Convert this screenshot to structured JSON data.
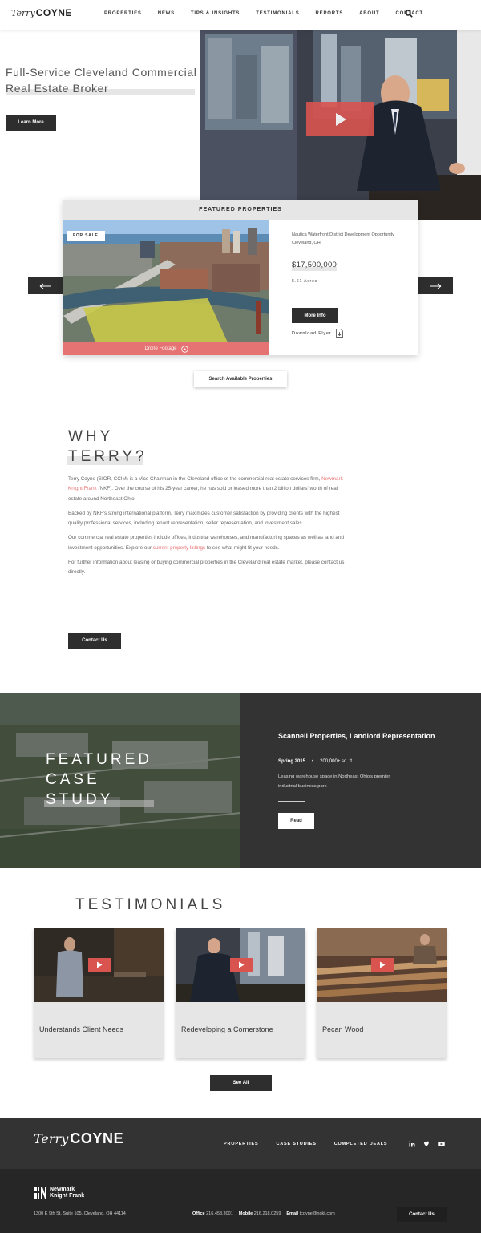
{
  "header": {
    "logo_script": "Terry",
    "logo_bold": "COYNE",
    "nav": [
      "PROPERTIES",
      "NEWS",
      "TIPS & INSIGHTS",
      "TESTIMONIALS",
      "REPORTS",
      "ABOUT",
      "CONTACT"
    ],
    "search_icon": "search-icon"
  },
  "hero": {
    "title": "Full-Service Cleveland Commercial Real Estate Broker",
    "button": "Learn More",
    "play_icon": "play-icon"
  },
  "featured": {
    "heading": "FEATURED PROPERTIES",
    "badge": "FOR SALE",
    "drone": "Drone Footage",
    "name": "Nautica Waterfront District Development Opportunity",
    "location": "Cleveland, OH",
    "price": "$17,500,000",
    "acres": "5.61 Acres",
    "more_info": "More Info",
    "download": "Download Flyer",
    "search_button": "Search Available Properties"
  },
  "why": {
    "title_line1": "WHY",
    "title_line2": "TERRY?",
    "p1_a": "Terry Coyne (SIOR, CCIM) is a Vice Chairman in the Cleveland office of the commercial real estate services firm, ",
    "p1_link": "Newmark Knight Frank",
    "p1_b": " (NKF). Over the course of his 25-year career, he has sold or leased more than 2 billion dollars' worth of real estate around Northeast Ohio.",
    "p2": "Backed by NKF's strong international platform, Terry maximizes customer satisfaction by providing clients with the highest quality professional services, including tenant representation, seller representation, and investment sales.",
    "p3_a": "Our commercial real estate properties include offices, industrial warehouses, and manufacturing spaces as well as land and investment opportunities. Explore our ",
    "p3_link": "current property listings",
    "p3_b": " to see what might fit your needs.",
    "p4": "For further information about leasing or buying commercial properties in the Cleveland real estate market, please contact us directly.",
    "button": "Contact Us"
  },
  "case_study": {
    "title_line1": "FEATURED",
    "title_line2": "CASE",
    "title_line3": "STUDY",
    "name": "Scannell Properties, Landlord Representation",
    "year": "Spring 2015",
    "sep": "•",
    "size": "200,000+ sq. ft.",
    "desc": "Leasing warehouse space in Northeast Ohio's premier industrial business park",
    "button": "Read"
  },
  "testimonials": {
    "title": "TESTIMONIALS",
    "items": [
      {
        "label": "Understands Client Needs"
      },
      {
        "label": "Redeveloping a Cornerstone"
      },
      {
        "label": "Pecan Wood"
      }
    ],
    "see_all": "See All"
  },
  "footer": {
    "logo_script": "Terry",
    "logo_bold": "COYNE",
    "nav": [
      "PROPERTIES",
      "CASE STUDIES",
      "COMPLETED DEALS"
    ],
    "social": [
      "linkedin-icon",
      "twitter-icon",
      "youtube-icon"
    ],
    "nkf_line1": "Newmark",
    "nkf_line2": "Knight Frank",
    "address": "1300 E 9th St, Suite 105, Cleveland, OH 44114",
    "office_label": "Office",
    "office": "216.453.3001",
    "mobile_label": "Mobile",
    "mobile": "216.218.0259",
    "email_label": "Email",
    "email": "tcoyne@ngkf.com",
    "button": "Contact Us"
  },
  "colors": {
    "accent": "#e57373",
    "dark": "#2e2e2e",
    "highlight": "#e6e6e6"
  }
}
